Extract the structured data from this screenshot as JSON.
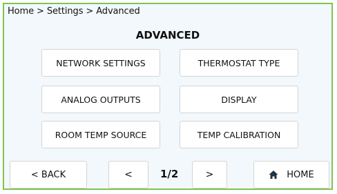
{
  "breadcrumb": "Home > Settings > Advanced",
  "page_title": "ADVANCED",
  "menu": {
    "network_settings": "NETWORK SETTINGS",
    "thermostat_type": "THERMOSTAT TYPE",
    "analog_outputs": "ANALOG OUTPUTS",
    "display": "DISPLAY",
    "room_temp_source": "ROOM TEMP SOURCE",
    "temp_calibration": "TEMP CALIBRATION"
  },
  "nav": {
    "back": "< BACK",
    "prev": "<",
    "page": "1/2",
    "next": ">",
    "home": "HOME",
    "home_icon": "house-icon"
  },
  "colors": {
    "frame_border": "#7ec44f",
    "background": "#f2f8fc",
    "button_bg": "#ffffff"
  }
}
